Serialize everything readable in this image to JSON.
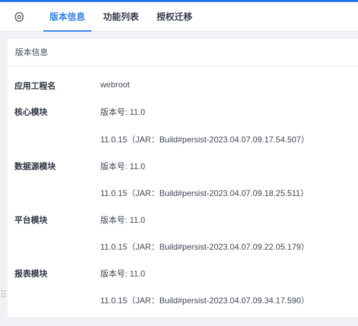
{
  "tabs": [
    {
      "label": "版本信息",
      "active": true
    },
    {
      "label": "功能列表",
      "active": false
    },
    {
      "label": "授权迁移",
      "active": false
    }
  ],
  "icons": {
    "settings": "gear-icon",
    "drag": "drag-handle-icon"
  },
  "colors": {
    "accent": "#2b7de9",
    "top_bar": "#1a73e8"
  },
  "panel": {
    "title": "版本信息",
    "rows": [
      {
        "label": "应用工程名",
        "value": "webroot",
        "detail": ""
      },
      {
        "label": "核心模块",
        "value": "版本号: 11.0",
        "detail": "11.0.15（JAR：Build#persist-2023.04.07.09.17.54.507）"
      },
      {
        "label": "数据源模块",
        "value": "版本号: 11.0",
        "detail": "11.0.15（JAR：Build#persist-2023.04.07.09.18.25.511）"
      },
      {
        "label": "平台模块",
        "value": "版本号: 11.0",
        "detail": "11.0.15（JAR：Build#persist-2023.04.07.09.22.05.179）"
      },
      {
        "label": "报表模块",
        "value": "版本号: 11.0",
        "detail": "11.0.15（JAR：Build#persist-2023.04.07.09.34.17.590）"
      }
    ]
  }
}
